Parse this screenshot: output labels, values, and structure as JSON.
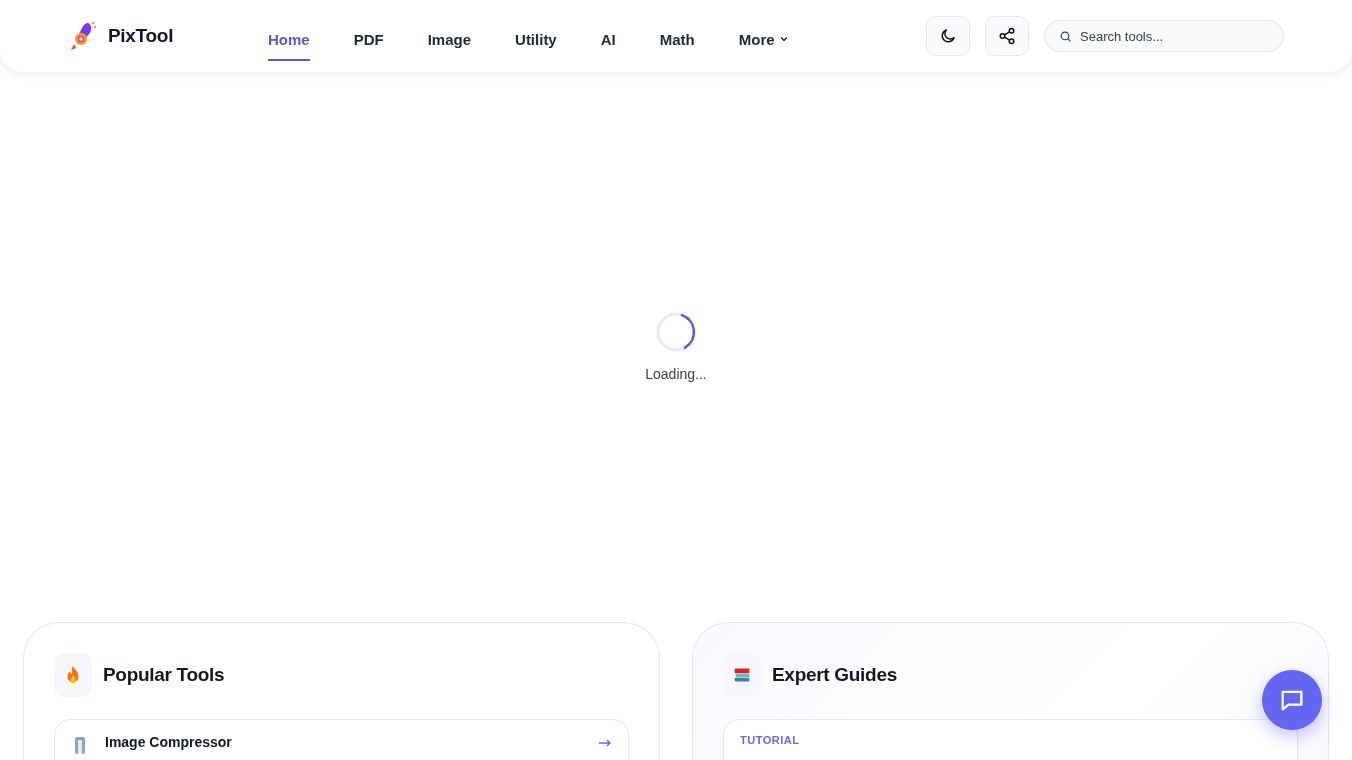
{
  "header": {
    "brand": "PixTool",
    "nav": [
      {
        "label": "Home",
        "selected": true
      },
      {
        "label": "PDF",
        "selected": false
      },
      {
        "label": "Image",
        "selected": false
      },
      {
        "label": "Utility",
        "selected": false
      },
      {
        "label": "AI",
        "selected": false
      },
      {
        "label": "Math",
        "selected": false
      },
      {
        "label": "More",
        "selected": false,
        "kind": "dropdown"
      }
    ],
    "search": {
      "placeholder": "Search tools..."
    }
  },
  "loading": {
    "text": "Loading..."
  },
  "cards": [
    {
      "kind": "tools",
      "title": "Popular Tools",
      "items": [
        {
          "label": "Image Compressor"
        }
      ]
    },
    {
      "kind": "guides",
      "title": "Expert Guides",
      "items": [
        {
          "label": "TUTORIAL"
        }
      ]
    }
  ]
}
